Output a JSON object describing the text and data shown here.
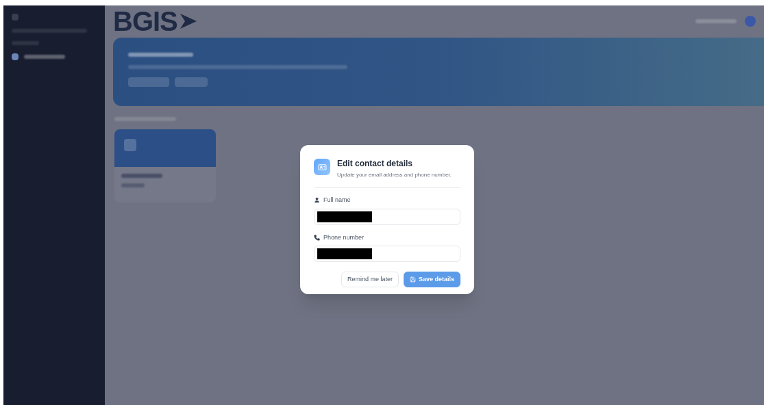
{
  "header": {
    "logo": "BGIS"
  },
  "dialog": {
    "title": "Edit contact details",
    "subtitle": "Update your email address and phone number.",
    "fields": [
      {
        "kind": "person",
        "label": "Full name",
        "redacted": true
      },
      {
        "kind": "phone",
        "label": "Phone number",
        "redacted": true
      }
    ],
    "buttons": [
      {
        "kind": "secondary",
        "label": "Remind me later"
      },
      {
        "kind": "primary",
        "label": "Save details"
      }
    ]
  }
}
